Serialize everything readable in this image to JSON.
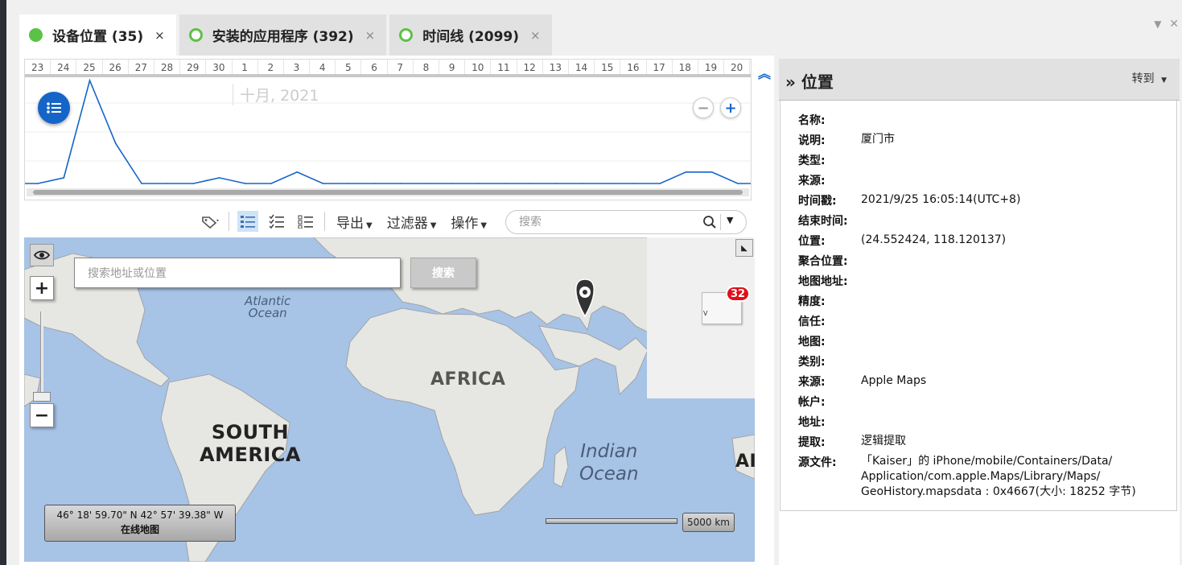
{
  "tabs": [
    {
      "label": "设备位置 (35)",
      "active": true,
      "close": "×"
    },
    {
      "label": "安装的应用程序 (392)",
      "active": false,
      "close": "×"
    },
    {
      "label": "时间线 (2099)",
      "active": false,
      "close": "×"
    }
  ],
  "timeline": {
    "days": [
      "23",
      "24",
      "25",
      "26",
      "27",
      "28",
      "29",
      "30",
      "1",
      "2",
      "3",
      "4",
      "5",
      "6",
      "7",
      "8",
      "9",
      "10",
      "11",
      "12",
      "13",
      "14",
      "15",
      "16",
      "17",
      "18",
      "19",
      "20"
    ],
    "month_label": "十月, 2021"
  },
  "chart_data": {
    "type": "line",
    "categories": [
      "23",
      "24",
      "25",
      "26",
      "27",
      "28",
      "29",
      "30",
      "1",
      "2",
      "3",
      "4",
      "5",
      "6",
      "7",
      "8",
      "9",
      "10",
      "11",
      "12",
      "13",
      "14",
      "15",
      "16",
      "17",
      "18",
      "19",
      "20"
    ],
    "series": [
      {
        "values": [
          0,
          1,
          18,
          7,
          0,
          0,
          0,
          1,
          0,
          0,
          2,
          0,
          0,
          0,
          0,
          0,
          0,
          0,
          0,
          0,
          0,
          0,
          0,
          0,
          0,
          2,
          2,
          0
        ]
      }
    ],
    "color": "#1565c8"
  },
  "toolbar": {
    "export_label": "导出",
    "filter_label": "过滤器",
    "actions_label": "操作",
    "search_placeholder": "搜索"
  },
  "map": {
    "search_placeholder": "搜索地址或位置",
    "search_button": "搜索",
    "labels": {
      "atlantic": "Atlantic\nOcean",
      "africa": "AFRICA",
      "south_america": "SOUTH\nAMERICA",
      "indian": "Indian\nOcean",
      "edge": "AI"
    },
    "cluster_count": "32",
    "coord_text": "46° 18' 59.70\" N 42° 57' 39.38\" W",
    "map_mode": "在线地图",
    "scale_label": "5000 km",
    "water_color": "#a7c3e6",
    "land_color": "#e4e4e0"
  },
  "details": {
    "title": "位置",
    "goto_label": "转到",
    "fields": [
      {
        "label": "名称:",
        "value": ""
      },
      {
        "label": "说明:",
        "value": "厦门市"
      },
      {
        "label": "类型:",
        "value": ""
      },
      {
        "label": "来源:",
        "value": ""
      },
      {
        "label": "时间戳:",
        "value": "2021/9/25 16:05:14(UTC+8)"
      },
      {
        "label": "结束时间:",
        "value": ""
      },
      {
        "label": "位置:",
        "value": "(24.552424, 118.120137)"
      },
      {
        "label": "聚合位置:",
        "value": ""
      },
      {
        "label": "地图地址:",
        "value": ""
      },
      {
        "label": "精度:",
        "value": ""
      },
      {
        "label": "信任:",
        "value": ""
      },
      {
        "label": "地图:",
        "value": ""
      },
      {
        "label": "类别:",
        "value": ""
      },
      {
        "label": "来源:",
        "value": "Apple Maps"
      },
      {
        "label": "帐户:",
        "value": ""
      },
      {
        "label": "地址:",
        "value": ""
      },
      {
        "label": "提取:",
        "value": "逻辑提取"
      },
      {
        "label": "源文件:",
        "value": "「Kaiser」的 iPhone/mobile/Containers/Data/\nApplication/com.apple.Maps/Library/Maps/\nGeoHistory.mapsdata : 0x4667(大小: 18252 字节)"
      }
    ]
  }
}
